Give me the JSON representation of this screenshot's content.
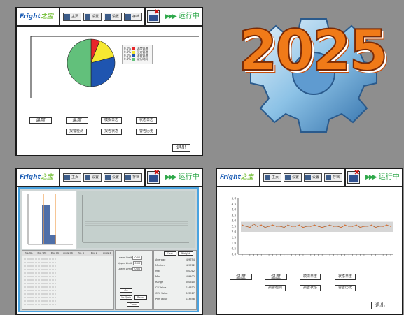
{
  "logo_text": "Fright",
  "logo_mark": "之宝",
  "nav": [
    "主页",
    "设置",
    "设置",
    "存档"
  ],
  "status": {
    "label": "运行中",
    "arrows": "▶▶▶"
  },
  "year_badge": "2025",
  "panel1": {
    "buttons": [
      "温度",
      "温度",
      "模拟日志",
      "状态日志",
      "报警检测",
      "报告状态",
      "警告历史"
    ],
    "exit": "退出",
    "pie": {
      "slices": [
        {
          "label": "温度管理",
          "value": 6,
          "color": "#e8262a"
        },
        {
          "label": "压力管理",
          "value": 15,
          "color": "#f6e832"
        },
        {
          "label": "流量管理",
          "value": 29,
          "color": "#1f55b0"
        },
        {
          "label": "运行时间",
          "value": 50,
          "color": "#62c07b"
        }
      ],
      "legend_prefix": [
        "0.0%",
        "0.0%",
        "0.0%",
        "0.0%"
      ]
    }
  },
  "panel2": {
    "table_headers": [
      "Pos. No.",
      "Pos. SPC",
      "Pos. OK",
      "Angle OK",
      "Pos. 1",
      "Pos. 2",
      "Angle 2"
    ],
    "params": [
      {
        "name": "Lower Limit",
        "value": "0.00"
      },
      {
        "name": "Upper Limit",
        "value": "0.00"
      },
      {
        "name": "Lower Limit",
        "value": "0.00"
      }
    ],
    "stats": [
      {
        "name": "Average",
        "value": "4.9754"
      },
      {
        "name": "Median",
        "value": "4.9762"
      },
      {
        "name": "Max",
        "value": "5.0012"
      },
      {
        "name": "Min",
        "value": "4.9402"
      },
      {
        "name": "Range",
        "value": "0.0610"
      },
      {
        "name": "CP Value",
        "value": "1.4832"
      },
      {
        "name": "CPK Value",
        "value": "1.3917"
      },
      {
        "name": "PPK Value",
        "value": "1.3558"
      }
    ],
    "tabs": [
      "Last",
      "Weight"
    ],
    "control_buttons": [
      "Go",
      "Analysis",
      "Reset",
      "Clear"
    ]
  },
  "panel3": {
    "buttons": [
      "温度",
      "温度",
      "模拟日志",
      "状态日志",
      "报警检测",
      "报告状态",
      "警告历史"
    ],
    "exit": "退出",
    "yticks": [
      "5.0",
      "4.5",
      "4.0",
      "3.5",
      "3.0",
      "2.5",
      "2.0",
      "1.5",
      "1.0",
      "0.5",
      "0.0"
    ],
    "line_values": [
      2.6,
      2.5,
      2.4,
      2.7,
      2.5,
      2.6,
      2.4,
      2.5,
      2.6,
      2.5,
      2.5,
      2.4,
      2.6,
      2.5,
      2.5,
      2.6,
      2.4,
      2.5,
      2.5,
      2.6,
      2.5,
      2.4,
      2.5,
      2.6,
      2.5,
      2.5,
      2.4,
      2.6,
      2.5,
      2.5,
      2.6,
      2.4,
      2.5,
      2.5,
      2.6,
      2.4,
      2.5,
      2.5,
      2.6,
      2.5
    ]
  }
}
